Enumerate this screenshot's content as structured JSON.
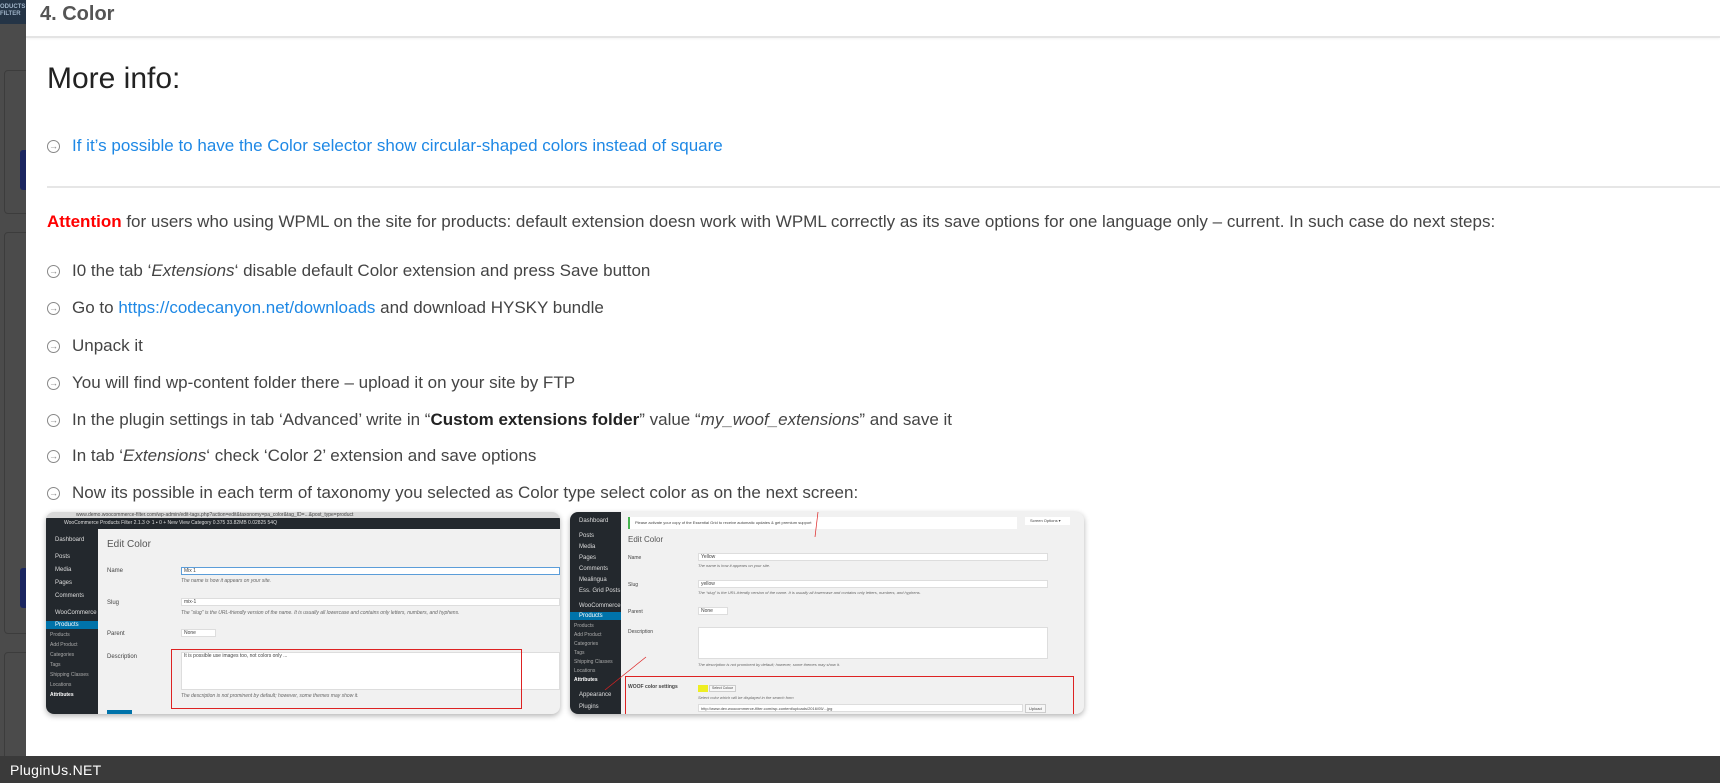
{
  "header": {
    "title": "4. Color"
  },
  "more_info": {
    "title": "More info:",
    "link": "If it’s possible to have the Color selector show circular-shaped colors instead of square"
  },
  "attention": {
    "label": "Attention",
    "text": " for users who using WPML on the site for products: default extension doesn work with WPML correctly as its save options for one language only – current. In such case do next steps:"
  },
  "steps": [
    {
      "pre": "I0 the tab ‘",
      "em": "Extensions",
      "post": "‘ disable default Color extension and press Save button"
    },
    {
      "pre": "Go to ",
      "link": "https://codecanyon.net/downloads",
      "post": " and download HYSKY bundle"
    },
    {
      "pre": "Unpack it"
    },
    {
      "pre": "You will find wp-content folder there – upload it on your site by FTP"
    },
    {
      "pre": "In the plugin settings in tab ‘Advanced’ write in “",
      "strong": "Custom extensions folder",
      "mid": "” value “",
      "em": "my_woof_extensions",
      "post": "” and save it"
    },
    {
      "pre": "In tab ‘",
      "em": "Extensions",
      "post": "‘ check ‘Color 2’ extension and save options"
    },
    {
      "pre": "Now its possible in each term of taxonomy you selected as Color type select color as on the next screen:"
    }
  ],
  "screenshot1": {
    "url": "www.demo.woocommerce-filter.com/wp-admin/edit-tags.php?action=edit&taxonomy=pa_color&tag_ID=...&post_type=product",
    "adminbar": "WooCommerce Products Filter 2.1.3   ⟳ 1   ▪ 0   + New   View Category   0.375  33.82MB  0.02825  54Q",
    "menu": [
      "Dashboard",
      "Posts",
      "Media",
      "Pages",
      "Comments",
      "WooCommerce",
      "Products"
    ],
    "submenu": [
      "Products",
      "Add Product",
      "Categories",
      "Tags",
      "Shipping Classes",
      "Locations",
      "Attributes"
    ],
    "title": "Edit Color",
    "name_label": "Name",
    "name_value": "Mix 1",
    "name_hint": "The name is how it appears on your site.",
    "slug_label": "Slug",
    "slug_value": "mix-1",
    "slug_hint": "The “slug” is the URL-friendly version of the name. It is usually all lowercase and contains only letters, numbers, and hyphens.",
    "parent_label": "Parent",
    "parent_value": "None",
    "desc_label": "Description",
    "desc_value": "It is possible use images too, not colors only ...",
    "desc_hint": "The description is not prominent by default; however, some themes may show it."
  },
  "screenshot2": {
    "notice": "Please activate your copy of the Essential Grid to receive automatic updates & get premium support",
    "screen_options": "Screen Options ▾",
    "menu": [
      "Dashboard",
      "Posts",
      "Media",
      "Pages",
      "Comments",
      "Mealingua",
      "Ess. Grid Posts",
      "WooCommerce",
      "Products"
    ],
    "submenu": [
      "Products",
      "Add Product",
      "Categories",
      "Tags",
      "Shipping Classes",
      "Locations",
      "Attributes"
    ],
    "menu_bottom": [
      "Appearance",
      "Plugins"
    ],
    "title": "Edit Color",
    "name_label": "Name",
    "name_value": "Yellow",
    "name_hint": "The name is how it appears on your site.",
    "slug_label": "Slug",
    "slug_value": "yellow",
    "slug_hint": "The “slug” is the URL-friendly version of the name. It is usually all lowercase and contains only letters, numbers, and hyphens.",
    "parent_label": "Parent",
    "parent_value": "None",
    "desc_label": "Description",
    "desc_hint": "The description is not prominent by default; however, some themes may show it.",
    "woof_label": "WOOF color settings",
    "select_colour": "Select Colour",
    "color_hint": "Select color which will be displayed in the search form",
    "image_url": "http://www.dev.woocommerce-filter.com/wp-content/uploads/2016/05/...jpg",
    "upload": "Upload",
    "swatch_color": "#eeee22"
  },
  "footer": {
    "brand": "PluginUs.NET"
  },
  "colors": {
    "link": "#1e88e5",
    "attention": "#ff0000"
  }
}
